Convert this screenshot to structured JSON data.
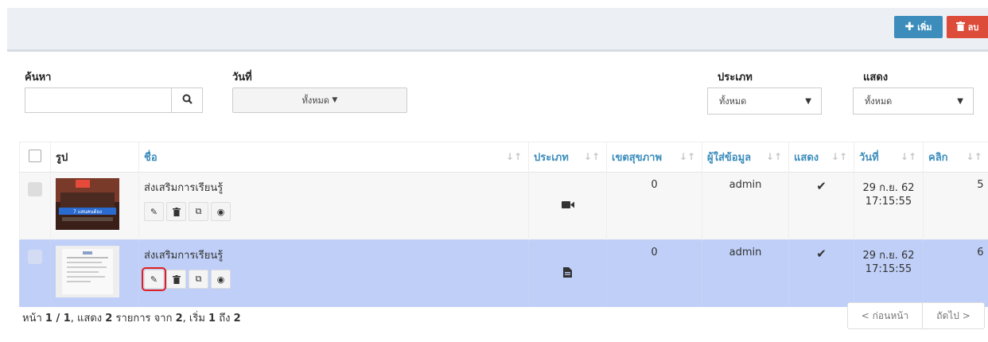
{
  "toolbar": {
    "add_label": "เพิ่ม",
    "delete_label": "ลบ",
    "add_color": "#3c8dbc",
    "delete_color": "#dd4b39"
  },
  "filters": {
    "search_label": "ค้นหา",
    "search_value": "",
    "date_label": "วันที่",
    "date_value": "ทั้งหมด",
    "type_label": "ประเภท",
    "type_value": "ทั้งหมด",
    "show_label": "แสดง",
    "show_value": "ทั้งหมด"
  },
  "table": {
    "headers": {
      "image": "รูป",
      "name": "ชื่อ",
      "type": "ประเภท",
      "zone": "เขตสุขภาพ",
      "author": "ผู้ใส่ข้อมูล",
      "show": "แสดง",
      "date": "วันที่",
      "clicks": "คลิก"
    },
    "rows": [
      {
        "name": "ส่งเสริมการเรียนรู้",
        "type_icon": "video-camera-icon",
        "zone": "0",
        "author": "admin",
        "shown": "✔",
        "date": "29 ก.ย. 62",
        "time": "17:15:55",
        "clicks": "5",
        "thumb_caption": "7 แสนคนต้อง",
        "selected": false
      },
      {
        "name": "ส่งเสริมการเรียนรู้",
        "type_icon": "document-icon",
        "zone": "0",
        "author": "admin",
        "shown": "✔",
        "date": "29 ก.ย. 62",
        "time": "17:15:55",
        "clicks": "6",
        "selected": true
      }
    ],
    "row_highlight_color": "#bfcff7"
  },
  "footer": {
    "summary_prefix": "หน้า ",
    "page": "1 / 1",
    "summary_mid1": ", แสดง ",
    "shown_count": "2",
    "summary_mid2": " รายการ จาก ",
    "total": "2",
    "summary_mid3": ", เริ่ม ",
    "start": "1",
    "summary_mid4": " ถึง ",
    "end": "2",
    "prev_label": "< ก่อนหน้า",
    "next_label": "ถัดไป >"
  }
}
